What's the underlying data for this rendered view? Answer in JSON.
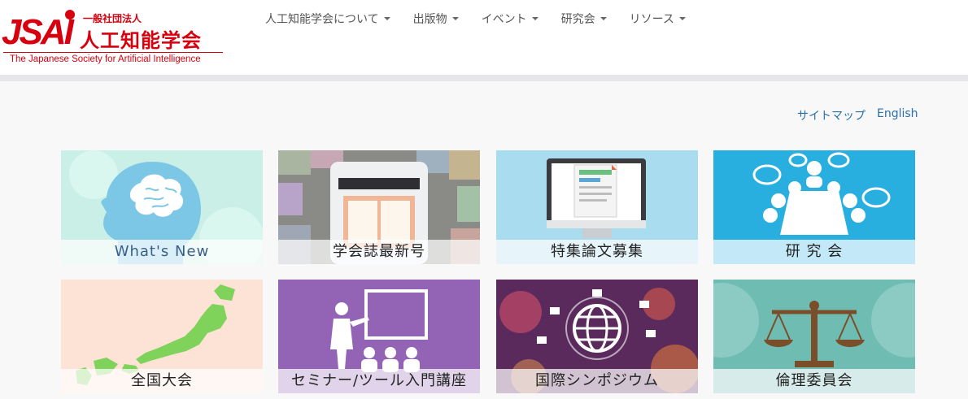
{
  "logo": {
    "mark": "JSAI",
    "corp": "一般社団法人",
    "org_name": "人工知能学会",
    "english_name": "The Japanese Society for Artificial Intelligence"
  },
  "nav": {
    "items": [
      {
        "label": "人工知能学会について"
      },
      {
        "label": "出版物"
      },
      {
        "label": "イベント"
      },
      {
        "label": "研究会"
      },
      {
        "label": "リソース"
      }
    ]
  },
  "util_links": {
    "sitemap": "サイトマップ",
    "english": "English"
  },
  "tiles": [
    {
      "label": "What's New",
      "icon": "brain-head-icon"
    },
    {
      "label": "学会誌最新号",
      "icon": "tablet-book-icon"
    },
    {
      "label": "特集論文募集",
      "icon": "monitor-document-icon"
    },
    {
      "label": "研 究 会",
      "icon": "meeting-people-icon"
    },
    {
      "label": "全国大会",
      "icon": "japan-map-icon"
    },
    {
      "label": "セミナー/ツール入門講座",
      "icon": "lecturer-board-icon"
    },
    {
      "label": "国際シンポジウム",
      "icon": "globe-icon"
    },
    {
      "label": "倫理委員会",
      "icon": "scales-icon"
    }
  ]
}
